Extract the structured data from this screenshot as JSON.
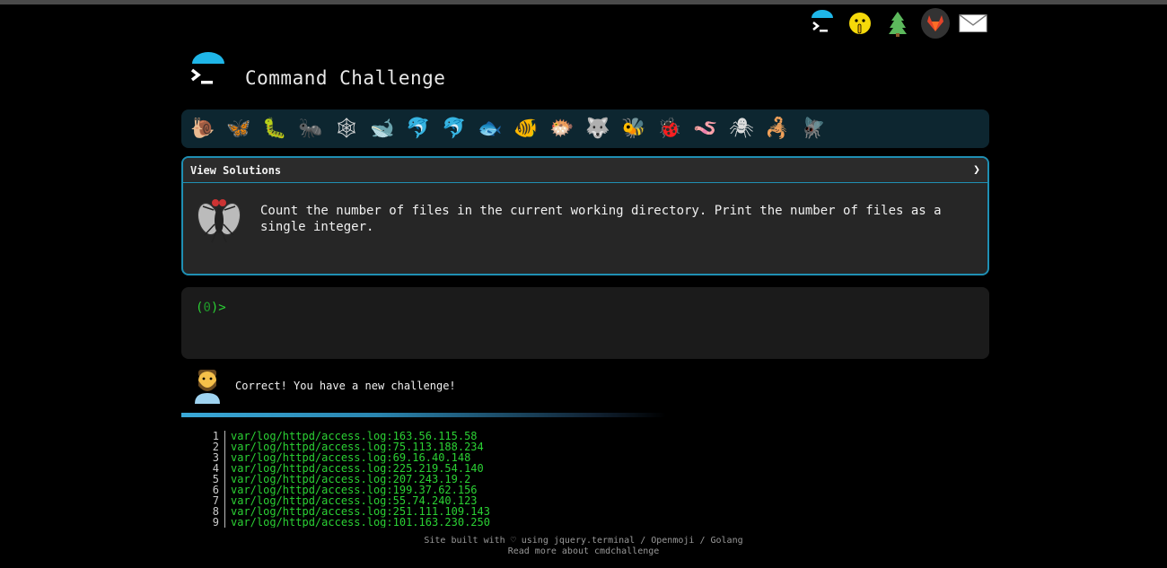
{
  "app": {
    "title": "Command Challenge"
  },
  "top_icons": [
    "terminal-icon",
    "shushing-face-icon",
    "tree-icon",
    "gitlab-icon",
    "envelope-icon"
  ],
  "creatures": [
    "snail",
    "butterfly",
    "caterpillar",
    "ant",
    "spider-web",
    "whale",
    "dolphin",
    "dolphin",
    "fish",
    "tropical-fish",
    "blowfish",
    "wolf",
    "bee",
    "ladybug",
    "worm",
    "spider",
    "scorpion",
    "fly"
  ],
  "creature_glyphs": [
    "🐌",
    "🦋",
    "🐛",
    "🐜",
    "🕸",
    "🐋",
    "🐬",
    "🐬",
    "🐟",
    "🐠",
    "🐡",
    "🐺",
    "🐝",
    "🐞",
    "🪱",
    "🕷",
    "🦂",
    "🪰"
  ],
  "challenge": {
    "solutions_label": "View Solutions",
    "chevron": "❯",
    "text": "Count the number of files in the current working directory. Print the number of files as a single integer."
  },
  "terminal": {
    "prompt_open": "(",
    "prompt_num": "0",
    "prompt_close": ")>"
  },
  "message": "Correct! You have a new challenge!",
  "output": [
    {
      "n": "1",
      "text": "var/log/httpd/access.log:163.56.115.58"
    },
    {
      "n": "2",
      "text": "var/log/httpd/access.log:75.113.188.234"
    },
    {
      "n": "3",
      "text": "var/log/httpd/access.log:69.16.40.148"
    },
    {
      "n": "4",
      "text": "var/log/httpd/access.log:225.219.54.140"
    },
    {
      "n": "5",
      "text": "var/log/httpd/access.log:207.243.19.2"
    },
    {
      "n": "6",
      "text": "var/log/httpd/access.log:199.37.62.156"
    },
    {
      "n": "7",
      "text": "var/log/httpd/access.log:55.74.240.123"
    },
    {
      "n": "8",
      "text": "var/log/httpd/access.log:251.111.109.143"
    },
    {
      "n": "9",
      "text": "var/log/httpd/access.log:101.163.230.250"
    }
  ],
  "footer": {
    "prefix": "Site built with ♡ using ",
    "link1": "jquery.terminal",
    "sep1": " / ",
    "link2": "Openmoji",
    "sep2": " / ",
    "link3": "Golang",
    "line2": "Read more about cmdchallenge"
  },
  "colors": {
    "accent": "#1f8fb3",
    "prompt_green": "#2bd134",
    "creature_bar": "#0d2630"
  }
}
